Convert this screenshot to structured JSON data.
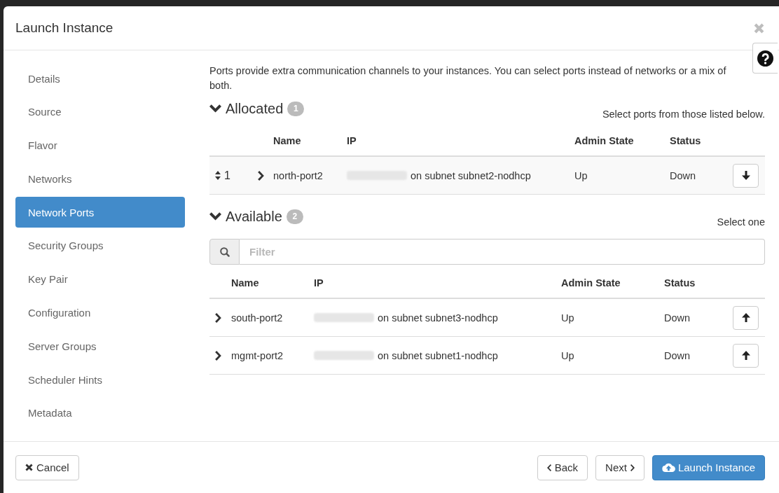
{
  "dialog": {
    "title": "Launch Instance"
  },
  "sidebar": {
    "items": [
      {
        "label": "Details",
        "selected": false
      },
      {
        "label": "Source",
        "selected": false
      },
      {
        "label": "Flavor",
        "selected": false
      },
      {
        "label": "Networks",
        "selected": false
      },
      {
        "label": "Network Ports",
        "selected": true
      },
      {
        "label": "Security Groups",
        "selected": false
      },
      {
        "label": "Key Pair",
        "selected": false
      },
      {
        "label": "Configuration",
        "selected": false
      },
      {
        "label": "Server Groups",
        "selected": false
      },
      {
        "label": "Scheduler Hints",
        "selected": false
      },
      {
        "label": "Metadata",
        "selected": false
      }
    ]
  },
  "description": "Ports provide extra communication channels to your instances. You can select ports instead of networks or a mix of both.",
  "sections": [
    {
      "kind": "allocated",
      "title": "Allocated",
      "count": "1",
      "expanded": true,
      "hint": "Select ports from those listed below.",
      "columns": [
        "Name",
        "IP",
        "Admin State",
        "Status"
      ],
      "rows": [
        {
          "order": "1",
          "expanded": false,
          "name": "north-port2",
          "ip_blurred": true,
          "ip": "on subnet subnet2-nodhcp",
          "admin_state": "Up",
          "status": "Down"
        }
      ]
    },
    {
      "kind": "available",
      "title": "Available",
      "count": "2",
      "expanded": true,
      "hint": "Select one",
      "filter": {
        "placeholder": "Filter"
      },
      "columns": [
        "Name",
        "IP",
        "Admin State",
        "Status"
      ],
      "rows": [
        {
          "expanded": false,
          "name": "south-port2",
          "ip_blurred": true,
          "ip": "on subnet subnet3-nodhcp",
          "admin_state": "Up",
          "status": "Down"
        },
        {
          "expanded": false,
          "name": "mgmt-port2",
          "ip_blurred": true,
          "ip": "on subnet subnet1-nodhcp",
          "admin_state": "Up",
          "status": "Down"
        }
      ]
    }
  ],
  "footer": {
    "buttons": [
      {
        "kind": "cancel",
        "label": "Cancel"
      },
      {
        "kind": "back",
        "label": "Back"
      },
      {
        "kind": "next",
        "label": "Next"
      },
      {
        "kind": "launch",
        "label": "Launch Instance"
      }
    ]
  }
}
